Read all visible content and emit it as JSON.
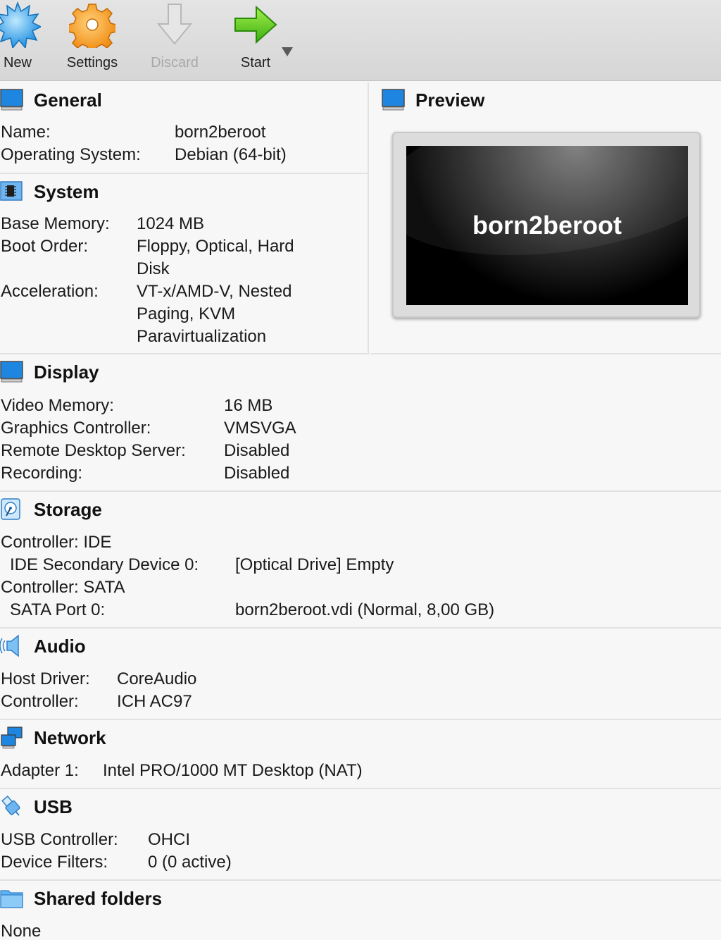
{
  "toolbar": {
    "new_label": "New",
    "settings_label": "Settings",
    "discard_label": "Discard",
    "start_label": "Start"
  },
  "general": {
    "title": "General",
    "name_label": "Name:",
    "name_value": "born2beroot",
    "os_label": "Operating System:",
    "os_value": "Debian (64-bit)"
  },
  "system": {
    "title": "System",
    "memory_label": "Base Memory:",
    "memory_value": "1024 MB",
    "boot_label": "Boot Order:",
    "boot_value_1": "Floppy, Optical, Hard",
    "boot_value_2": "Disk",
    "accel_label": "Acceleration:",
    "accel_value_1": "VT-x/AMD-V, Nested",
    "accel_value_2": "Paging, KVM",
    "accel_value_3": "Paravirtualization"
  },
  "preview": {
    "title": "Preview",
    "vm_name": "born2beroot"
  },
  "display": {
    "title": "Display",
    "video_label": "Video Memory:",
    "video_value": "16 MB",
    "graphics_label": "Graphics Controller:",
    "graphics_value": "VMSVGA",
    "rdp_label": "Remote Desktop Server:",
    "rdp_value": "Disabled",
    "recording_label": "Recording:",
    "recording_value": "Disabled"
  },
  "storage": {
    "title": "Storage",
    "controller_ide": "Controller: IDE",
    "ide_device_label": "IDE Secondary Device 0:",
    "ide_device_value": "[Optical Drive] Empty",
    "controller_sata": "Controller: SATA",
    "sata_port_label": "SATA Port 0:",
    "sata_port_value": "born2beroot.vdi (Normal, 8,00 GB)"
  },
  "audio": {
    "title": "Audio",
    "host_label": "Host Driver:",
    "host_value": "CoreAudio",
    "controller_label": "Controller:",
    "controller_value": "ICH AC97"
  },
  "network": {
    "title": "Network",
    "adapter_label": "Adapter 1:",
    "adapter_value": "Intel PRO/1000 MT Desktop (NAT)"
  },
  "usb": {
    "title": "USB",
    "controller_label": "USB Controller:",
    "controller_value": "OHCI",
    "filters_label": "Device Filters:",
    "filters_value": "0 (0 active)"
  },
  "shared_folders": {
    "title": "Shared folders",
    "value": "None"
  }
}
